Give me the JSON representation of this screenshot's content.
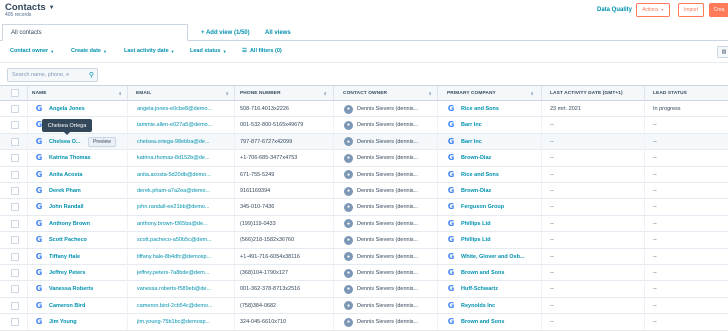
{
  "header": {
    "title": "Contacts",
    "records": "405 records",
    "data_quality": "Data Quality",
    "actions_label": "Actions",
    "import_label": "Import",
    "create_label": "Crea"
  },
  "views": {
    "active_tab": "All contacts",
    "add_view": "+ Add view (1/50)",
    "all_views": "All views"
  },
  "filters": {
    "contact_owner": "Contact owner",
    "create_date": "Create date",
    "last_activity": "Last activity date",
    "lead_status": "Lead status",
    "all_filters": "All filters (0)"
  },
  "search": {
    "placeholder": "Search name, phone, e"
  },
  "columns": {
    "name": "NAME",
    "email": "EMAIL",
    "phone": "PHONE NUMBER",
    "owner": "CONTACT OWNER",
    "company": "PRIMARY COMPANY",
    "last_activity": "LAST ACTIVITY DATE (GMT+1)",
    "lead_status": "LEAD STATUS"
  },
  "tooltip": "Chelsea Ortega",
  "preview_label": "Preview",
  "icons": {
    "sort": "sort-icon",
    "company_logo": "google-icon",
    "search": "search-icon",
    "avatar": "owner-avatar"
  },
  "colors": {
    "accent": "#0091ae",
    "orange": "#ff7a59",
    "text": "#33475b"
  },
  "rows": [
    {
      "name": "Angela Jones",
      "email": "angela.jones-e0cbe8@demo...",
      "phone": "508-716.4013x2226",
      "owner": "Dennis Sievers (dennis...",
      "company": "Rice and Sons",
      "activity": "23 mrt. 2021",
      "lead": "In progress"
    },
    {
      "name": "",
      "email": "tammie.allen-e027a5@demo...",
      "phone": "001-532-800-5165x49679",
      "owner": "Dennis Sievers (dennis...",
      "company": "Barr Inc",
      "activity": "--",
      "lead": "--"
    },
    {
      "name": "Chelsea O...",
      "email": "chelsea.ortega-98ebba@de...",
      "phone": "797-877-6727x42099",
      "owner": "Dennis Sievers (dennis...",
      "company": "Barr Inc",
      "activity": "--",
      "lead": "--"
    },
    {
      "name": "Katrina Thomas",
      "email": "katrina.thomas-8d152b@de...",
      "phone": "+1-706-685-3477x4753",
      "owner": "Dennis Sievers (dennis...",
      "company": "Brown-Diaz",
      "activity": "--",
      "lead": "--"
    },
    {
      "name": "Anita Acosta",
      "email": "anita.acosta-5d20db@demo...",
      "phone": "671-755-5249",
      "owner": "Dennis Sievers (dennis...",
      "company": "Rice and Sons",
      "activity": "--",
      "lead": "--"
    },
    {
      "name": "Derek Pham",
      "email": "derek.pham-a7a2ea@demo...",
      "phone": "9161169394",
      "owner": "Dennis Sievers (dennis...",
      "company": "Brown-Diaz",
      "activity": "--",
      "lead": "--"
    },
    {
      "name": "John Randall",
      "email": "john.randall-ee21bb@demo...",
      "phone": "345-010-7436",
      "owner": "Dennis Sievers (dennis...",
      "company": "Ferguson Group",
      "activity": "--",
      "lead": "--"
    },
    {
      "name": "Anthony Brown",
      "email": "anthony.brown-f365ba@de...",
      "phone": "(199)119-0433",
      "owner": "Dennis Sievers (dennis...",
      "company": "Phillips Ltd",
      "activity": "--",
      "lead": "--"
    },
    {
      "name": "Scott Pacheco",
      "email": "scott.pacheco-a50b5c@dem...",
      "phone": "(566)218-1582x36760",
      "owner": "Dennis Sievers (dennis...",
      "company": "Phillips Ltd",
      "activity": "--",
      "lead": "--"
    },
    {
      "name": "Tiffany Hale",
      "email": "tiffany.hale-8b4dfc@demosp...",
      "phone": "+1-491-716-6054x38116",
      "owner": "Dennis Sievers (dennis...",
      "company": "White, Glover and Osb...",
      "activity": "--",
      "lead": "--"
    },
    {
      "name": "Jeffrey Peters",
      "email": "jeffrey.peters-7a8bde@dem...",
      "phone": "(368)104-1790x127",
      "owner": "Dennis Sievers (dennis...",
      "company": "Brown and Sons",
      "activity": "--",
      "lead": "--"
    },
    {
      "name": "Vanessa Roberts",
      "email": "vanessa.roberts-f589eb@de...",
      "phone": "001-362-378-8713x2516",
      "owner": "Dennis Sievers (dennis...",
      "company": "Huff-Schwartz",
      "activity": "--",
      "lead": "--"
    },
    {
      "name": "Cameron Bird",
      "email": "cameron.bird-2cb54c@demo...",
      "phone": "(758)384-0682",
      "owner": "Dennis Sievers (dennis...",
      "company": "Reynolds Inc",
      "activity": "--",
      "lead": "--"
    },
    {
      "name": "Jim Young",
      "email": "jim.young-75b1bc@demosp...",
      "phone": "324-045-6610x710",
      "owner": "Dennis Sievers (dennis...",
      "company": "Brown and Sons",
      "activity": "--",
      "lead": "--"
    }
  ]
}
